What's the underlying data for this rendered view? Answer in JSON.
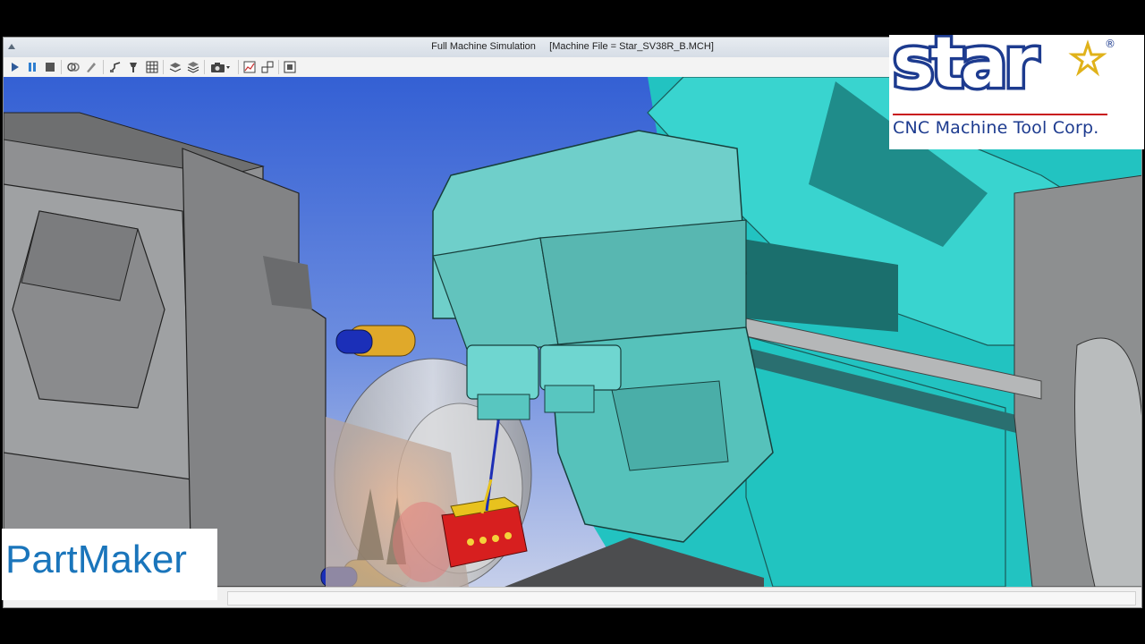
{
  "window": {
    "title": "Full Machine Simulation     [Machine File = Star_SV38R_B.MCH]"
  },
  "toolbar": {
    "buttons": [
      "play-icon",
      "pause-icon",
      "stop-icon",
      "rewind-icon",
      "pen-icon",
      "tool-path-icon",
      "tool-holder-icon",
      "grid-icon",
      "layer-icon",
      "stack-icon",
      "camera-icon",
      "chart-icon",
      "swap-icon",
      "frame-icon"
    ]
  },
  "logo": {
    "brand_text": "star",
    "registered": "®",
    "tagline": "CNC Machine Tool Corp.",
    "brand_color": "#1d3b8f",
    "accent_color": "#c8151b",
    "star_color": "#e0b21a"
  },
  "watermark": {
    "text": "PartMaker",
    "color": "#1a75bb"
  },
  "scene": {
    "sky_color": "#3d6fd8",
    "turret_color": "#4ecdc4",
    "part_color": "#d71f1f",
    "machine_color": "#8c8c8c"
  }
}
